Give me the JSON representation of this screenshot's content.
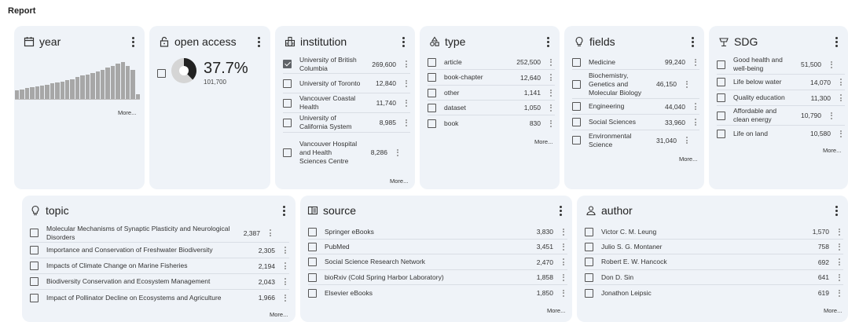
{
  "report_title": "Report",
  "year": {
    "title": "year",
    "bars": [
      0.22,
      0.24,
      0.26,
      0.28,
      0.3,
      0.33,
      0.35,
      0.38,
      0.4,
      0.43,
      0.46,
      0.49,
      0.53,
      0.57,
      0.6,
      0.64,
      0.68,
      0.72,
      0.76,
      0.8,
      0.87,
      0.91,
      0.8,
      0.72,
      0.12
    ],
    "more": "More..."
  },
  "open_access": {
    "title": "open access",
    "percent_text": "37.7%",
    "percent": 0.377,
    "count": "101,700"
  },
  "institution": {
    "title": "institution",
    "items": [
      {
        "label": "University of British Columbia",
        "count": "269,600",
        "checked": true
      },
      {
        "label": "University of Toronto",
        "count": "12,840",
        "checked": false
      },
      {
        "label": "Vancouver Coastal Health",
        "count": "11,740",
        "checked": false
      },
      {
        "label": "University of California System",
        "count": "8,985",
        "checked": false
      },
      {
        "label": "Vancouver Hospital and Health Sciences Centre",
        "count": "8,286",
        "checked": false
      }
    ],
    "more": "More..."
  },
  "type": {
    "title": "type",
    "items": [
      {
        "label": "article",
        "count": "252,500"
      },
      {
        "label": "book-chapter",
        "count": "12,640"
      },
      {
        "label": "other",
        "count": "1,141"
      },
      {
        "label": "dataset",
        "count": "1,050"
      },
      {
        "label": "book",
        "count": "830"
      }
    ],
    "more": "More..."
  },
  "fields": {
    "title": "fields",
    "items": [
      {
        "label": "Medicine",
        "count": "99,240"
      },
      {
        "label": "Biochemistry, Genetics and Molecular Biology",
        "count": "46,150"
      },
      {
        "label": "Engineering",
        "count": "44,040"
      },
      {
        "label": "Social Sciences",
        "count": "33,960"
      },
      {
        "label": "Environmental Science",
        "count": "31,040"
      }
    ],
    "more": "More..."
  },
  "sdg": {
    "title": "SDG",
    "items": [
      {
        "label": "Good health and well-being",
        "count": "51,500"
      },
      {
        "label": "Life below water",
        "count": "14,070"
      },
      {
        "label": "Quality education",
        "count": "11,300"
      },
      {
        "label": "Affordable and clean energy",
        "count": "10,790"
      },
      {
        "label": "Life on land",
        "count": "10,580"
      }
    ],
    "more": "More..."
  },
  "topic": {
    "title": "topic",
    "items": [
      {
        "label": "Molecular Mechanisms of Synaptic Plasticity and Neurological Disorders",
        "count": "2,387"
      },
      {
        "label": "Importance and Conservation of Freshwater Biodiversity",
        "count": "2,305"
      },
      {
        "label": "Impacts of Climate Change on Marine Fisheries",
        "count": "2,194"
      },
      {
        "label": "Biodiversity Conservation and Ecosystem Management",
        "count": "2,043"
      },
      {
        "label": "Impact of Pollinator Decline on Ecosystems and Agriculture",
        "count": "1,966"
      }
    ],
    "more": "More..."
  },
  "source": {
    "title": "source",
    "items": [
      {
        "label": "Springer eBooks",
        "count": "3,830"
      },
      {
        "label": "PubMed",
        "count": "3,451"
      },
      {
        "label": "Social Science Research Network",
        "count": "2,470"
      },
      {
        "label": "bioRxiv (Cold Spring Harbor Laboratory)",
        "count": "1,858"
      },
      {
        "label": "Elsevier eBooks",
        "count": "1,850"
      }
    ],
    "more": "More..."
  },
  "author": {
    "title": "author",
    "items": [
      {
        "label": "Victor C. M. Leung",
        "count": "1,570"
      },
      {
        "label": "Julio S. G. Montaner",
        "count": "758"
      },
      {
        "label": "Robert E. W. Hancock",
        "count": "692"
      },
      {
        "label": "Don D. Sin",
        "count": "641"
      },
      {
        "label": "Jonathon Leipsic",
        "count": "619"
      }
    ],
    "more": "More..."
  },
  "colors": {
    "card_bg": "#eff3f8",
    "bar": "#a7a7a7",
    "pie_dark": "#222222",
    "pie_light": "#d5d5d5"
  }
}
